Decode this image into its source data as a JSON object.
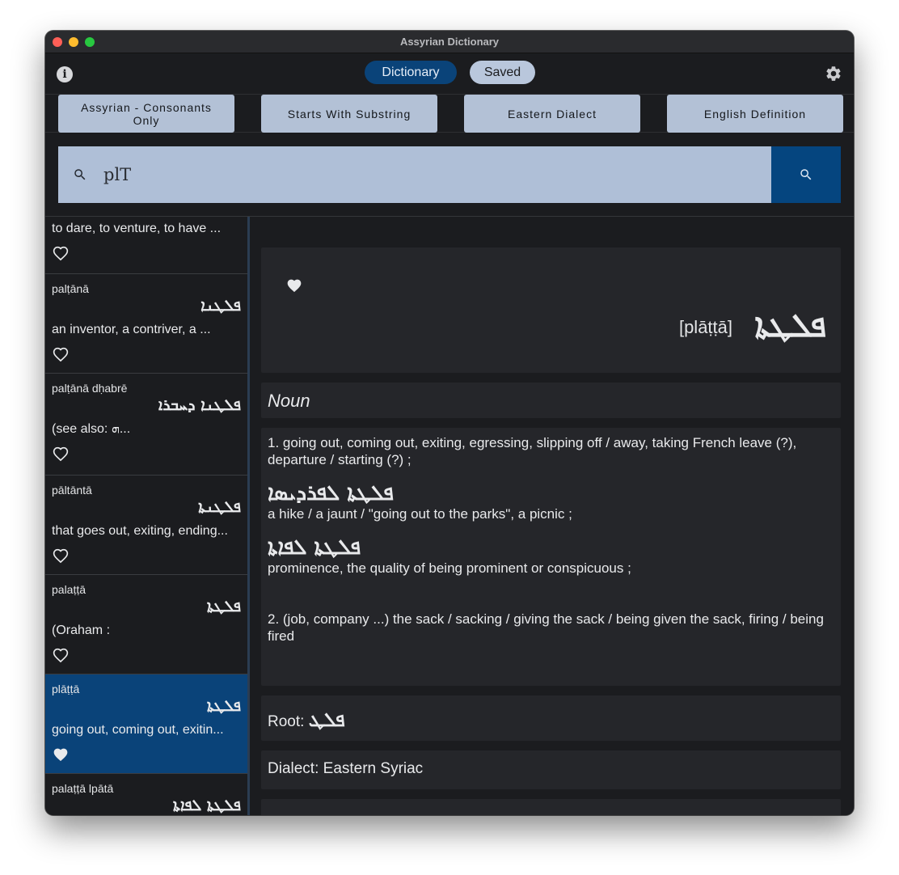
{
  "window": {
    "title": "Assyrian Dictionary"
  },
  "topbar": {
    "tabs": [
      {
        "label": "Dictionary",
        "active": true
      },
      {
        "label": "Saved",
        "active": false
      }
    ]
  },
  "filters": [
    {
      "label": "Assyrian - Consonants Only"
    },
    {
      "label": "Starts With Substring"
    },
    {
      "label": "Eastern Dialect"
    },
    {
      "label": "English Definition"
    }
  ],
  "search": {
    "value": "plT"
  },
  "results": [
    {
      "translit": "",
      "syriac": "",
      "definition": "to dare, to venture,  to have ...",
      "saved": false,
      "selected": false
    },
    {
      "translit": "palṭānā",
      "syriac": "ܦܠܛܢܐ",
      "definition": "an inventor, a contriver, a ...",
      "saved": false,
      "selected": false
    },
    {
      "translit": "palṭānā dḥabrē",
      "syriac": "ܦܠܛܢܐ ܕܚܒܪܐ",
      "definition": "(see also: ܗ...",
      "saved": false,
      "selected": false
    },
    {
      "translit": "pāltāntā",
      "syriac": "ܦܠܛܢܬܐ",
      "definition": "that goes out, exiting, ending...",
      "saved": false,
      "selected": false
    },
    {
      "translit": "palaṭṭā",
      "syriac": "ܦܠܛܬܐ",
      "definition": "(Oraham :",
      "saved": false,
      "selected": false
    },
    {
      "translit": "plāṭṭā",
      "syriac": "ܦܠܛܬܐ",
      "definition": "going out, coming out, exitin...",
      "saved": true,
      "selected": true
    },
    {
      "translit": "palaṭṭā lpātā",
      "syriac": "ܦܠܛܬܐ ܠܦܐܬܐ",
      "definition": "",
      "saved": false,
      "selected": false
    }
  ],
  "detail": {
    "translit": "[plāṭṭā]",
    "syriac": "ܦܠܛܬܐ",
    "saved": true,
    "part_of_speech": "Noun",
    "def1": "1. going out, coming out, exiting, egressing, slipping off / away, taking French leave (?), departure / starting (?) ;",
    "phrase1_syriac": "ܦܠܛܬܐ ܠܦܪܕܝܣܐ",
    "phrase1_def": "a hike / a jaunt / \"going out to the parks\", a picnic ;",
    "phrase2_syriac": "ܦܠܛܬܐ ܠܦܐܬܐ",
    "phrase2_def": "prominence, the quality of being prominent or conspicuous ;",
    "def2": "2. (job, company ...) the sack / sacking / giving the sack / being given the sack, firing / being fired",
    "root_label": "Root:",
    "root_syriac": "ܦܠܛ",
    "dialect_label": "Dialect:",
    "dialect_value": "Eastern Syriac"
  }
}
